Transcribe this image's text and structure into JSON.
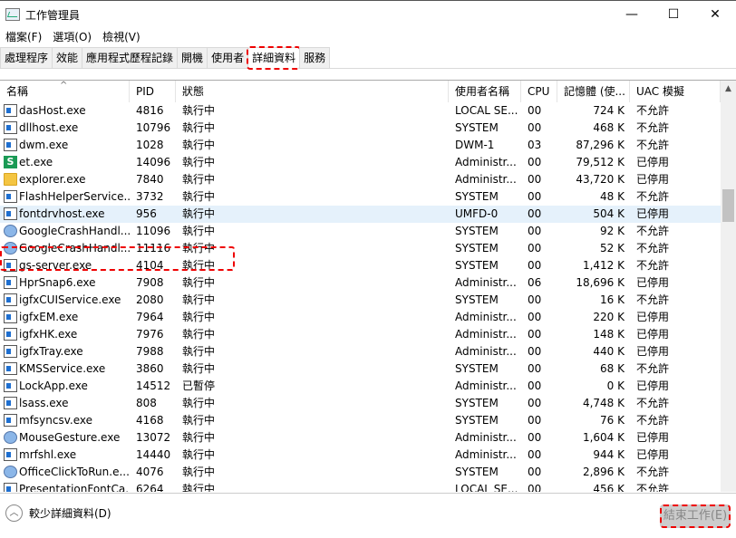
{
  "window": {
    "title": "工作管理員",
    "minimize": "—",
    "maximize": "☐",
    "close": "✕"
  },
  "menu": [
    "檔案(F)",
    "選項(O)",
    "檢視(V)"
  ],
  "tabs": [
    "處理程序",
    "效能",
    "應用程式歷程記錄",
    "開機",
    "使用者",
    "詳細資料",
    "服務"
  ],
  "active_tab": 5,
  "columns": [
    "名稱",
    "PID",
    "狀態",
    "使用者名稱",
    "CPU",
    "記憶體 (使...",
    "UAC 模擬"
  ],
  "rows": [
    {
      "name": "dasHost.exe",
      "pid": "4816",
      "status": "執行中",
      "user": "LOCAL SE...",
      "cpu": "00",
      "mem": "724 K",
      "uac": "不允許",
      "icon": "window"
    },
    {
      "name": "dllhost.exe",
      "pid": "10796",
      "status": "執行中",
      "user": "SYSTEM",
      "cpu": "00",
      "mem": "468 K",
      "uac": "不允許",
      "icon": "window"
    },
    {
      "name": "dwm.exe",
      "pid": "1028",
      "status": "執行中",
      "user": "DWM-1",
      "cpu": "03",
      "mem": "87,296 K",
      "uac": "不允許",
      "icon": "window"
    },
    {
      "name": "et.exe",
      "pid": "14096",
      "status": "執行中",
      "user": "Administr...",
      "cpu": "00",
      "mem": "79,512 K",
      "uac": "已停用",
      "icon": "S"
    },
    {
      "name": "explorer.exe",
      "pid": "7840",
      "status": "執行中",
      "user": "Administr...",
      "cpu": "00",
      "mem": "43,720 K",
      "uac": "已停用",
      "icon": "folder"
    },
    {
      "name": "FlashHelperService....",
      "pid": "3732",
      "status": "執行中",
      "user": "SYSTEM",
      "cpu": "00",
      "mem": "48 K",
      "uac": "不允許",
      "icon": "window"
    },
    {
      "name": "fontdrvhost.exe",
      "pid": "956",
      "status": "執行中",
      "user": "UMFD-0",
      "cpu": "00",
      "mem": "504 K",
      "uac": "已停用",
      "icon": "window"
    },
    {
      "name": "GoogleCrashHandl...",
      "pid": "11096",
      "status": "執行中",
      "user": "SYSTEM",
      "cpu": "00",
      "mem": "92 K",
      "uac": "不允許",
      "icon": "globe"
    },
    {
      "name": "GoogleCrashHandl...",
      "pid": "11116",
      "status": "執行中",
      "user": "SYSTEM",
      "cpu": "00",
      "mem": "52 K",
      "uac": "不允許",
      "icon": "globe"
    },
    {
      "name": "gs-server.exe",
      "pid": "4104",
      "status": "執行中",
      "user": "SYSTEM",
      "cpu": "00",
      "mem": "1,412 K",
      "uac": "不允許",
      "icon": "window"
    },
    {
      "name": "HprSnap6.exe",
      "pid": "7908",
      "status": "執行中",
      "user": "Administr...",
      "cpu": "06",
      "mem": "18,696 K",
      "uac": "已停用",
      "icon": "window"
    },
    {
      "name": "igfxCUIService.exe",
      "pid": "2080",
      "status": "執行中",
      "user": "SYSTEM",
      "cpu": "00",
      "mem": "16 K",
      "uac": "不允許",
      "icon": "window"
    },
    {
      "name": "igfxEM.exe",
      "pid": "7964",
      "status": "執行中",
      "user": "Administr...",
      "cpu": "00",
      "mem": "220 K",
      "uac": "已停用",
      "icon": "window"
    },
    {
      "name": "igfxHK.exe",
      "pid": "7976",
      "status": "執行中",
      "user": "Administr...",
      "cpu": "00",
      "mem": "148 K",
      "uac": "已停用",
      "icon": "window"
    },
    {
      "name": "igfxTray.exe",
      "pid": "7988",
      "status": "執行中",
      "user": "Administr...",
      "cpu": "00",
      "mem": "440 K",
      "uac": "已停用",
      "icon": "window"
    },
    {
      "name": "KMSService.exe",
      "pid": "3860",
      "status": "執行中",
      "user": "SYSTEM",
      "cpu": "00",
      "mem": "68 K",
      "uac": "不允許",
      "icon": "window"
    },
    {
      "name": "LockApp.exe",
      "pid": "14512",
      "status": "已暫停",
      "user": "Administr...",
      "cpu": "00",
      "mem": "0 K",
      "uac": "已停用",
      "icon": "window"
    },
    {
      "name": "lsass.exe",
      "pid": "808",
      "status": "執行中",
      "user": "SYSTEM",
      "cpu": "00",
      "mem": "4,748 K",
      "uac": "不允許",
      "icon": "window"
    },
    {
      "name": "mfsyncsv.exe",
      "pid": "4168",
      "status": "執行中",
      "user": "SYSTEM",
      "cpu": "00",
      "mem": "76 K",
      "uac": "不允許",
      "icon": "window"
    },
    {
      "name": "MouseGesture.exe",
      "pid": "13072",
      "status": "執行中",
      "user": "Administr...",
      "cpu": "00",
      "mem": "1,604 K",
      "uac": "已停用",
      "icon": "globe"
    },
    {
      "name": "mrfshl.exe",
      "pid": "14440",
      "status": "執行中",
      "user": "Administr...",
      "cpu": "00",
      "mem": "944 K",
      "uac": "已停用",
      "icon": "window"
    },
    {
      "name": "OfficeClickToRun.e...",
      "pid": "4076",
      "status": "執行中",
      "user": "SYSTEM",
      "cpu": "00",
      "mem": "2,896 K",
      "uac": "不允許",
      "icon": "globe"
    },
    {
      "name": "PresentationFontCa...",
      "pid": "6264",
      "status": "執行中",
      "user": "LOCAL SE...",
      "cpu": "00",
      "mem": "456 K",
      "uac": "不允許",
      "icon": "window"
    }
  ],
  "selected_row": 6,
  "highlighted_row": 4,
  "footer": {
    "less_details": "較少詳細資料(D)",
    "end_task": "結束工作(E)"
  }
}
